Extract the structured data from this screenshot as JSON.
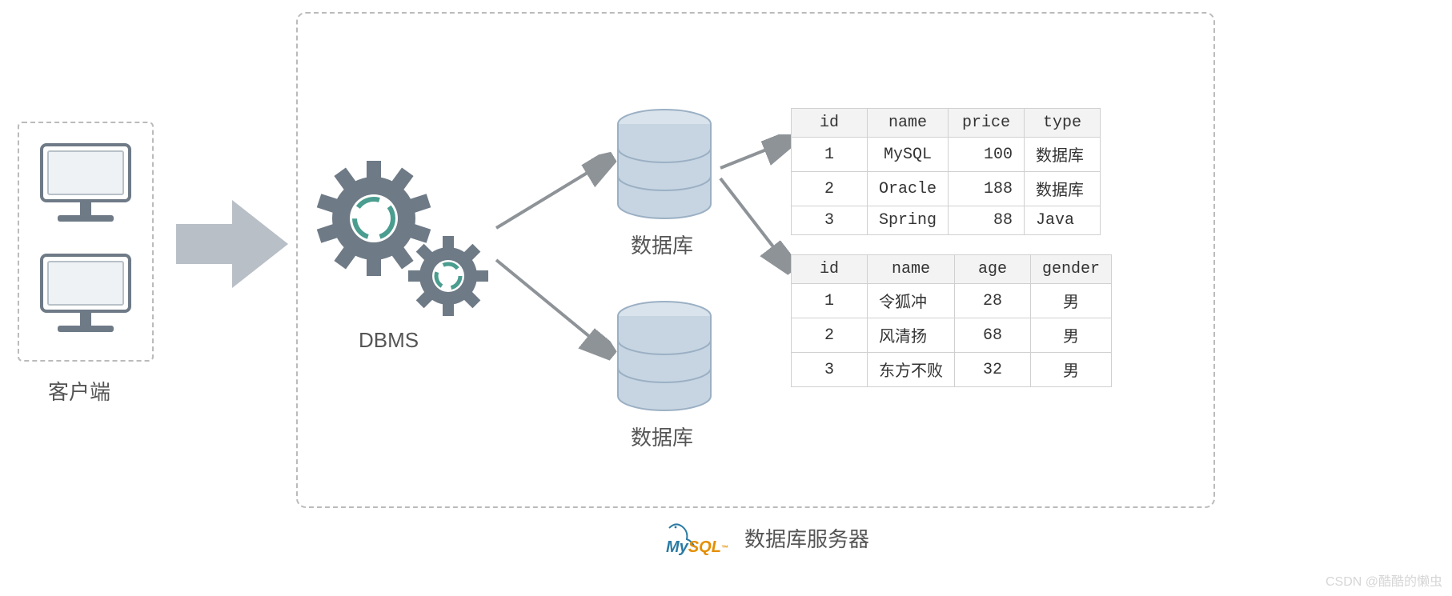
{
  "client": {
    "label": "客户端"
  },
  "server": {
    "label": "数据库服务器",
    "logo_text_my": "My",
    "logo_text_sql": "SQL",
    "logo_tm": "™"
  },
  "dbms": {
    "label": "DBMS"
  },
  "db": {
    "label1": "数据库",
    "label2": "数据库"
  },
  "table1": {
    "headers": [
      "id",
      "name",
      "price",
      "type"
    ],
    "rows": [
      {
        "id": "1",
        "name": "MySQL",
        "price": "100",
        "type": "数据库"
      },
      {
        "id": "2",
        "name": "Oracle",
        "price": "188",
        "type": "数据库"
      },
      {
        "id": "3",
        "name": "Spring",
        "price": "88",
        "type": "Java"
      }
    ]
  },
  "table2": {
    "headers": [
      "id",
      "name",
      "age",
      "gender"
    ],
    "rows": [
      {
        "id": "1",
        "name": "令狐冲",
        "age": "28",
        "gender": "男"
      },
      {
        "id": "2",
        "name": "风清扬",
        "age": "68",
        "gender": "男"
      },
      {
        "id": "3",
        "name": "东方不败",
        "age": "32",
        "gender": "男"
      }
    ]
  },
  "watermark": "CSDN @酷酷的懒虫"
}
